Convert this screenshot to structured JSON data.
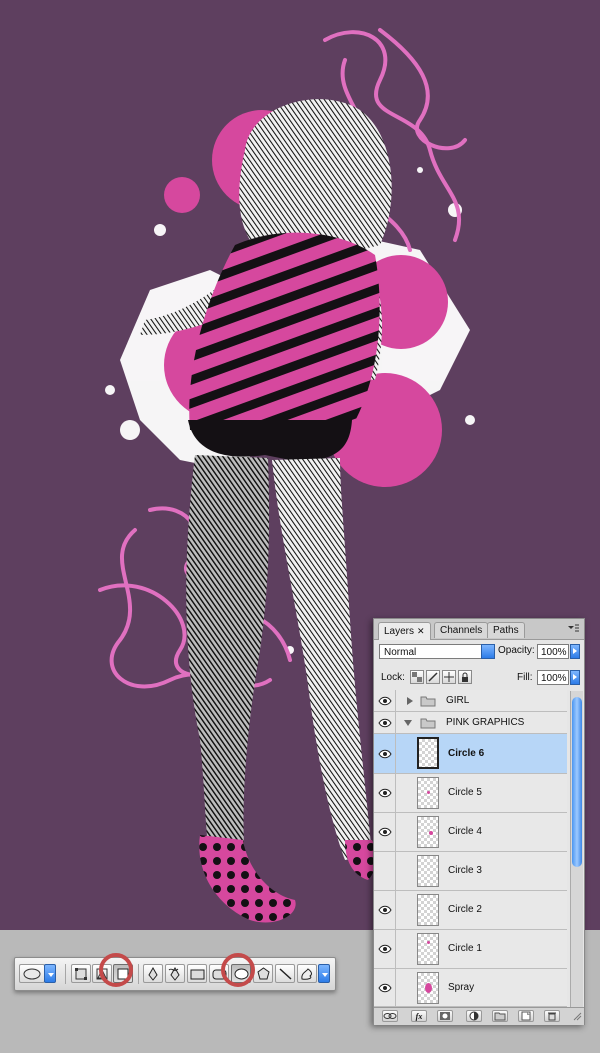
{
  "panel": {
    "tabs": [
      {
        "label": "Layers",
        "close": "✕"
      },
      {
        "label": "Channels"
      },
      {
        "label": "Paths"
      }
    ],
    "blend_mode": "Normal",
    "opacity_label": "Opacity:",
    "opacity_value": "100%",
    "lock_label": "Lock:",
    "fill_label": "Fill:",
    "fill_value": "100%",
    "layers": [
      {
        "name": "GIRL",
        "type": "group",
        "expanded": false
      },
      {
        "name": "PINK GRAPHICS",
        "type": "group",
        "expanded": true
      },
      {
        "name": "Circle 6",
        "type": "layer",
        "selected": true
      },
      {
        "name": "Circle 5",
        "type": "layer"
      },
      {
        "name": "Circle 4",
        "type": "layer"
      },
      {
        "name": "Circle 3",
        "type": "layer"
      },
      {
        "name": "Circle 2",
        "type": "layer"
      },
      {
        "name": "Circle 1",
        "type": "layer"
      },
      {
        "name": "Spray",
        "type": "layer"
      }
    ],
    "footer_fx": "fx"
  },
  "colors": {
    "background": "#5e3f5f",
    "accent_pink": "#d6489e",
    "selection_blue": "#b7d6f7",
    "highlight_ring": "#c44a4a"
  },
  "shape_bar": {
    "icons": [
      "ellipse-preset-icon",
      "shape-layers-icon",
      "paths-icon",
      "fill-pixels-icon",
      "pen-icon",
      "freeform-pen-icon",
      "rectangle-icon",
      "rounded-rectangle-icon",
      "ellipse-icon",
      "polygon-icon",
      "line-icon",
      "custom-shape-icon"
    ]
  }
}
